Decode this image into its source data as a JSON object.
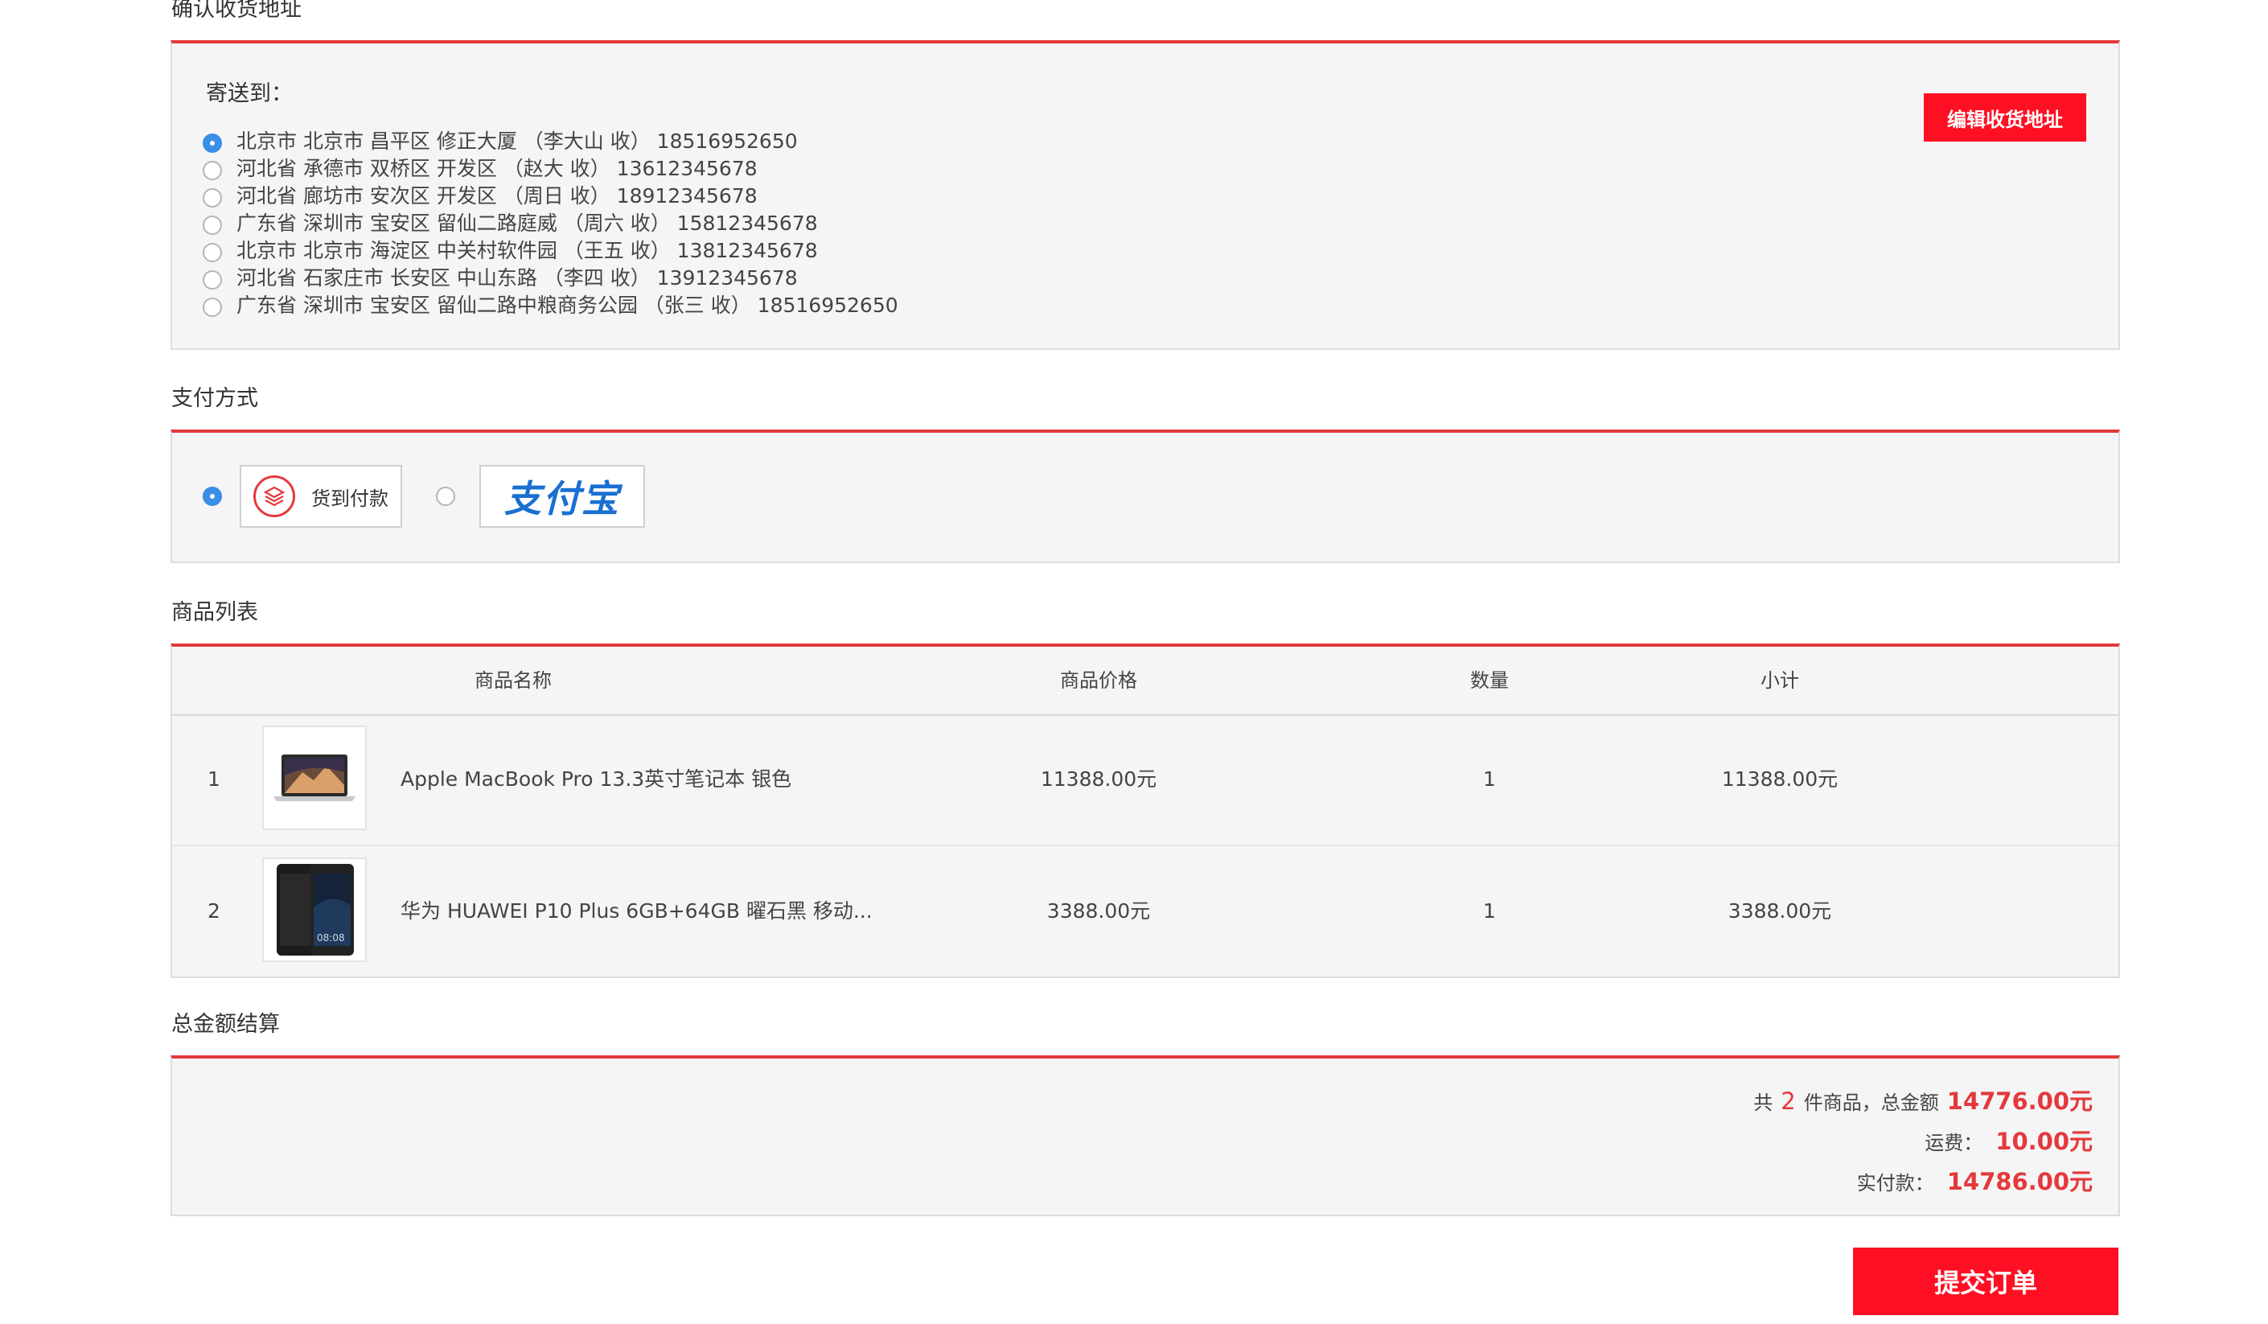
{
  "address": {
    "section_title": "确认收货地址",
    "send_to_label": "寄送到：",
    "edit_button": "编辑收货地址",
    "items": [
      {
        "text": "北京市 北京市 昌平区 修正大厦 （李大山 收） 18516952650",
        "selected": true
      },
      {
        "text": "河北省 承德市 双桥区 开发区 （赵大 收） 13612345678",
        "selected": false
      },
      {
        "text": "河北省 廊坊市 安次区 开发区 （周日 收） 18912345678",
        "selected": false
      },
      {
        "text": "广东省 深圳市 宝安区 留仙二路庭威 （周六 收） 15812345678",
        "selected": false
      },
      {
        "text": "北京市 北京市 海淀区 中关村软件园 （王五 收） 13812345678",
        "selected": false
      },
      {
        "text": "河北省 石家庄市 长安区 中山东路 （李四 收） 13912345678",
        "selected": false
      },
      {
        "text": "广东省 深圳市 宝安区 留仙二路中粮商务公园 （张三 收） 18516952650",
        "selected": false
      }
    ]
  },
  "payment": {
    "section_title": "支付方式",
    "cod_label": "货到付款",
    "cod_selected": true,
    "alipay_logo_text": "支付宝",
    "alipay_selected": false
  },
  "products": {
    "section_title": "商品列表",
    "headers": {
      "name": "商品名称",
      "price": "商品价格",
      "qty": "数量",
      "subtotal": "小计"
    },
    "rows": [
      {
        "index": "1",
        "name": "Apple MacBook Pro 13.3英寸笔记本 银色",
        "price": "11388.00元",
        "qty": "1",
        "subtotal": "11388.00元",
        "image": "laptop-image"
      },
      {
        "index": "2",
        "name": "华为 HUAWEI P10 Plus 6GB+64GB 曜石黑 移动...",
        "price": "3388.00元",
        "qty": "1",
        "subtotal": "3388.00元",
        "image": "phone-image"
      }
    ]
  },
  "summary": {
    "section_title": "总金额结算",
    "count_prefix": "共",
    "count": "2",
    "count_suffix": "件商品，总金额",
    "total": "14776.00元",
    "shipping_label": "运费：",
    "shipping": "10.00元",
    "pay_label": "实付款：",
    "pay_total": "14786.00元"
  },
  "submit_button": "提交订单",
  "colors": {
    "accent": "#e4393c",
    "button_red": "#ff0f23",
    "radio_blue": "#3a8ee6"
  }
}
